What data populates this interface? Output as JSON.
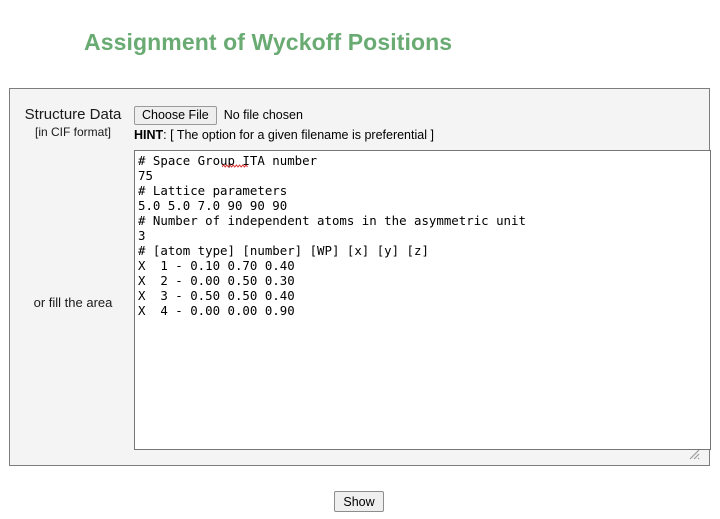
{
  "page": {
    "title": "Assignment of Wyckoff Positions",
    "title_color": "#69ab73",
    "background_color": "#ffffff"
  },
  "form": {
    "panel_background": "#f4f4f4",
    "panel_border_color": "#7d7d7d",
    "labels": {
      "structure_data": "Structure Data",
      "cif_format": "[in CIF format]",
      "fill_area": "or fill the area"
    },
    "file_input": {
      "button_label": "Choose File",
      "status_text": "No file chosen"
    },
    "hint": {
      "label": "HINT",
      "separator": ": ",
      "text": "[ The option for a given filename is preferential ]"
    },
    "textarea": {
      "placeholder": "",
      "value": "# Space Group ITA number\n75\n# Lattice parameters\n5.0 5.0 7.0 90 90 90\n# Number of independent atoms in the asymmetric unit\n3\n# [atom type] [number] [WP] [x] [y] [z]\nX  1 - 0.10 0.70 0.40\nX  2 - 0.00 0.50 0.30\nX  3 - 0.50 0.50 0.40\nX  4 - 0.00 0.00 0.90",
      "lines": [
        "# Space Group ITA number",
        "75",
        "# Lattice parameters",
        "5.0 5.0 7.0 90 90 90",
        "# Number of independent atoms in the asymmetric unit",
        "3",
        "# [atom type] [number] [WP] [x] [y] [z]",
        "X  1 - 0.10 0.70 0.40",
        "X  2 - 0.00 0.50 0.30",
        "X  3 - 0.50 0.50 0.40",
        "X  4 - 0.00 0.00 0.90"
      ],
      "misspelled_word": "ITA",
      "spellcheck_color": "#dd2222"
    },
    "submit": {
      "label": "Show"
    }
  }
}
